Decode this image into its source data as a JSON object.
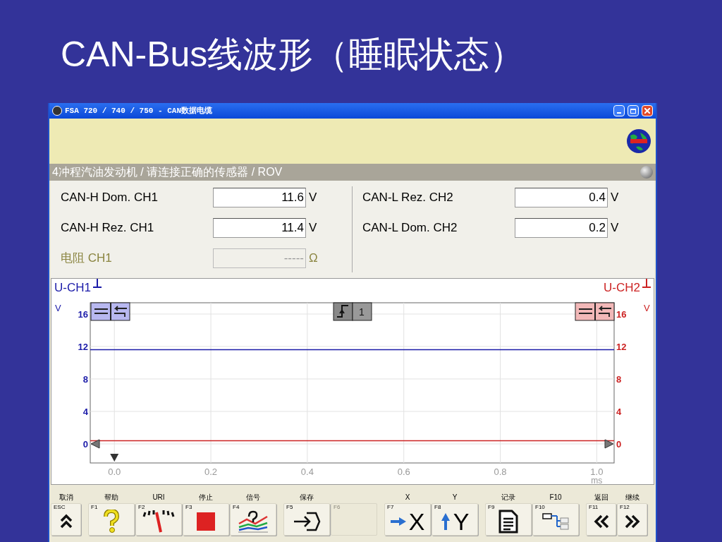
{
  "slide_title": "CAN-Bus线波形（睡眠状态）",
  "window": {
    "title": "FSA 720 / 740 / 750 - CAN数据电缆"
  },
  "status_bar": {
    "text": "4冲程汽油发动机 / 请连接正确的传感器 / ROV"
  },
  "readings_left": [
    {
      "label": "CAN-H Dom. CH1",
      "value": "11.6",
      "unit": "V",
      "disabled": false
    },
    {
      "label": "CAN-H Rez. CH1",
      "value": "11.4",
      "unit": "V",
      "disabled": false
    },
    {
      "label": "电阻 CH1",
      "value": "-----",
      "unit": "Ω",
      "disabled": true
    }
  ],
  "readings_right": [
    {
      "label": "CAN-L Rez. CH2",
      "value": "0.4",
      "unit": "V",
      "disabled": false
    },
    {
      "label": "CAN-L Dom. CH2",
      "value": "0.2",
      "unit": "V",
      "disabled": false
    }
  ],
  "trigger": {
    "label": "1"
  },
  "chart_data": {
    "type": "line",
    "xlabel": "ms",
    "ylabel": "V",
    "y2label": "V",
    "grid": true,
    "x": [
      -0.05,
      1.036
    ],
    "series": [
      {
        "name": "U-CH1",
        "color": "#1a1aa8",
        "values": [
          11.6,
          11.6
        ]
      },
      {
        "name": "U-CH2",
        "color": "#cc2222",
        "values": [
          0.4,
          0.4
        ]
      }
    ],
    "xlim": [
      -0.05,
      1.036
    ],
    "ylim": [
      -2.35,
      17.39
    ],
    "y2lim": [
      -2.35,
      17.39
    ],
    "xticks": [
      {
        "value": 0,
        "label": "0.0"
      },
      {
        "value": 0.2,
        "label": "0.2"
      },
      {
        "value": 0.4,
        "label": "0.4"
      },
      {
        "value": 0.6,
        "label": "0.6"
      },
      {
        "value": 0.8,
        "label": "0.8"
      },
      {
        "value": 1.0,
        "label": "1.0"
      }
    ],
    "yticks": [
      {
        "value": 16,
        "label": "16"
      },
      {
        "value": 12,
        "label": "12"
      },
      {
        "value": 8,
        "label": "8"
      },
      {
        "value": 4,
        "label": "4"
      },
      {
        "value": 0,
        "label": "0"
      }
    ],
    "y2ticks": [
      {
        "value": 16,
        "label": "16"
      },
      {
        "value": 12,
        "label": "12"
      },
      {
        "value": 8,
        "label": "8"
      },
      {
        "value": 4,
        "label": "4"
      },
      {
        "value": 0,
        "label": "0"
      }
    ]
  },
  "toolbar": [
    {
      "buttons": [
        {
          "label": "取消",
          "key": "ESC",
          "kind": "up",
          "disabled": false
        }
      ]
    },
    {
      "buttons": [
        {
          "label": "帮助",
          "key": "F1",
          "kind": "help",
          "disabled": false
        },
        {
          "label": "URI",
          "key": "F2",
          "kind": "gauge",
          "disabled": false
        },
        {
          "label": "停止",
          "key": "F3",
          "kind": "stop",
          "disabled": false
        },
        {
          "label": "信号",
          "key": "F4",
          "kind": "signal",
          "disabled": false
        }
      ]
    },
    {
      "buttons": [
        {
          "label": "保存",
          "key": "F5",
          "kind": "save",
          "disabled": false
        },
        {
          "key": "F6",
          "kind": "empty",
          "disabled": true
        }
      ]
    },
    {
      "buttons": [
        {
          "label": "X",
          "key": "F7",
          "kind": "x_axis",
          "glyph": "X",
          "disabled": false
        },
        {
          "label": "Y",
          "key": "F8",
          "kind": "y_axis",
          "glyph": "Y",
          "disabled": false
        }
      ]
    },
    {
      "buttons": [
        {
          "label": "记录",
          "key": "F9",
          "kind": "document",
          "disabled": false
        },
        {
          "label": "F10",
          "key": "F10",
          "kind": "layout",
          "disabled": false
        }
      ]
    },
    {
      "buttons": [
        {
          "label": "返回",
          "key": "F11",
          "kind": "back",
          "disabled": false
        },
        {
          "label": "继续",
          "key": "F12",
          "kind": "forward",
          "disabled": false
        }
      ]
    }
  ]
}
